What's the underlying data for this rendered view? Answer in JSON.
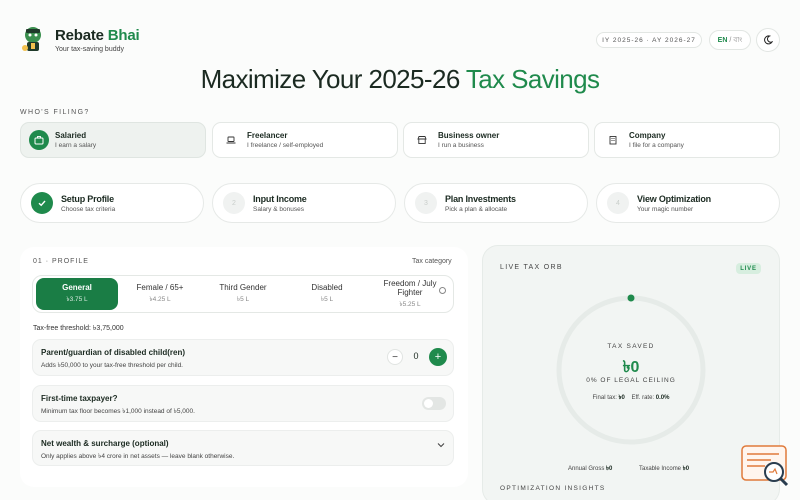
{
  "header": {
    "brand_part1": "Rebate ",
    "brand_part2": "Bhai",
    "tagline": "Your tax-saving buddy",
    "year": "IY 2025-26 · AY 2026-27",
    "lang_active": "EN",
    "lang_sep": "/",
    "lang_other": "বাং"
  },
  "hero": {
    "part1": "Maximize Your 2025-26 ",
    "part2": "Tax Savings"
  },
  "filing": {
    "label": "WHO'S FILING?",
    "options": [
      {
        "title": "Salaried",
        "subtitle": "I earn a salary",
        "icon": "briefcase-icon"
      },
      {
        "title": "Freelancer",
        "subtitle": "I freelance / self-employed",
        "icon": "laptop-icon"
      },
      {
        "title": "Business owner",
        "subtitle": "I run a business",
        "icon": "store-icon"
      },
      {
        "title": "Company",
        "subtitle": "I file for a company",
        "icon": "building-icon"
      }
    ]
  },
  "steps": [
    {
      "num": "1",
      "title": "Setup Profile",
      "subtitle": "Choose tax criteria"
    },
    {
      "num": "2",
      "title": "Input Income",
      "subtitle": "Salary & bonuses"
    },
    {
      "num": "3",
      "title": "Plan Investments",
      "subtitle": "Pick a plan & allocate"
    },
    {
      "num": "4",
      "title": "View Optimization",
      "subtitle": "Your magic number"
    }
  ],
  "profile": {
    "label": "01 · PROFILE",
    "tax_category_label": "Tax category",
    "categories": [
      {
        "title": "General",
        "amount": "৳3.75 L"
      },
      {
        "title": "Female / 65+",
        "amount": "৳4.25 L"
      },
      {
        "title": "Third Gender",
        "amount": "৳5 L"
      },
      {
        "title": "Disabled",
        "amount": "৳5 L"
      },
      {
        "title": "Freedom / July Fighter",
        "amount": "৳5.25 L"
      }
    ],
    "threshold": "Tax-free threshold: ৳3,75,000",
    "disabled_child": {
      "title": "Parent/guardian of disabled child(ren)",
      "desc": "Adds ৳50,000 to your tax-free threshold per child.",
      "count": "0",
      "minus": "−",
      "plus": "+"
    },
    "first_time": {
      "title": "First-time taxpayer?",
      "desc": "Minimum tax floor becomes ৳1,000 instead of ৳5,000."
    },
    "net_wealth": {
      "title": "Net wealth & surcharge (optional)",
      "desc": "Only applies above ৳4 crore in net assets — leave blank otherwise."
    }
  },
  "orb": {
    "label": "LIVE TAX ORB",
    "badge": "LIVE",
    "saved_label": "TAX SAVED",
    "saved_value": "৳0",
    "ceiling": "0% OF LEGAL CEILING",
    "final_tax_label": "Final tax:",
    "final_tax_value": "৳0",
    "eff_rate_label": "Eff. rate:",
    "eff_rate_value": "0.0%",
    "progress": 0,
    "gross_label": "Annual Gross",
    "gross_value": "৳0",
    "taxable_label": "Taxable Income",
    "taxable_value": "৳0",
    "insights_label": "OPTIMIZATION INSIGHTS"
  },
  "colors": {
    "accent": "#1f8a4c",
    "accent_dark": "#1a7d45"
  }
}
